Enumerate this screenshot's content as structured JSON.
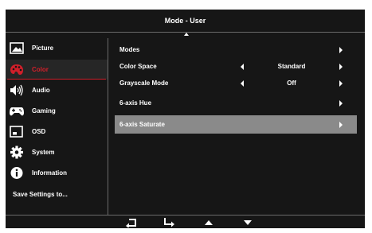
{
  "header": {
    "title": "Mode - User"
  },
  "sidebar": {
    "items": [
      {
        "label": "Picture",
        "icon": "picture-icon"
      },
      {
        "label": "Color",
        "icon": "palette-icon"
      },
      {
        "label": "Audio",
        "icon": "speaker-icon"
      },
      {
        "label": "Gaming",
        "icon": "gamepad-icon"
      },
      {
        "label": "OSD",
        "icon": "osd-icon"
      },
      {
        "label": "System",
        "icon": "gear-icon"
      },
      {
        "label": "Information",
        "icon": "info-icon"
      }
    ],
    "save_label": "Save Settings to..."
  },
  "content": {
    "rows": [
      {
        "label": "Modes"
      },
      {
        "label": "Color Space",
        "value": "Standard"
      },
      {
        "label": "Grayscale Mode",
        "value": "Off"
      },
      {
        "label": "6-axis Hue"
      },
      {
        "label": "6-axis Saturate"
      }
    ]
  },
  "footer": {
    "buttons": [
      "back-icon",
      "enter-icon",
      "up-arrow-icon",
      "down-arrow-icon"
    ]
  },
  "colors": {
    "background": "#161616",
    "accent": "#d11f2a",
    "selected_row": "#8a8a8a",
    "divider": "#6a6a6a"
  }
}
